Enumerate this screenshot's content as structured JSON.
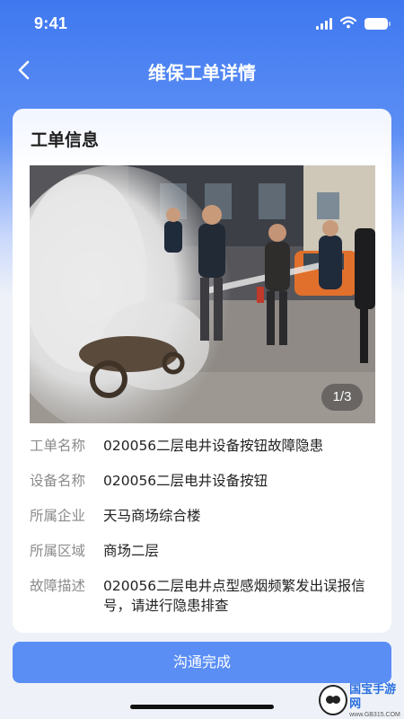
{
  "status_bar": {
    "time": "9:41"
  },
  "nav": {
    "title": "维保工单详情",
    "back_icon": "chevron-left-icon"
  },
  "card": {
    "title": "工单信息",
    "photo": {
      "pager": "1/3",
      "subject": "fire-extinguisher-drill-photo"
    },
    "fields": [
      {
        "label": "工单名称",
        "value": "020056二层电井设备按钮故障隐患"
      },
      {
        "label": "设备名称",
        "value": "020056二层电井设备按钮"
      },
      {
        "label": "所属企业",
        "value": "天马商场综合楼"
      },
      {
        "label": "所属区域",
        "value": "商场二层"
      },
      {
        "label": "故障描述",
        "value": "020056二层电井点型感烟频繁发出误报信号，请进行隐患排查"
      }
    ]
  },
  "action": {
    "label": "沟通完成"
  },
  "watermark": {
    "name": "国宝手游网",
    "url": "www.GB315.COM"
  },
  "colors": {
    "primary": "#5a8ef5",
    "header_gradient_top": "#3f78f0"
  }
}
